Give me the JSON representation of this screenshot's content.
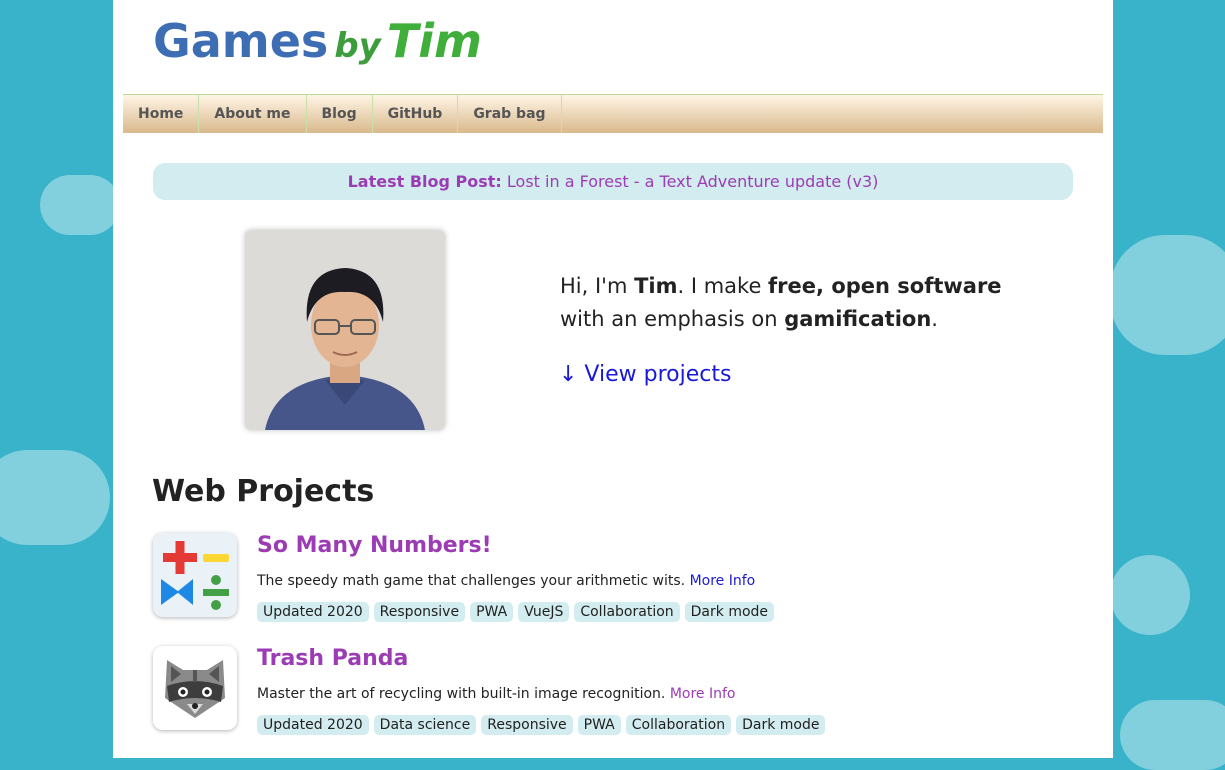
{
  "logo": {
    "word1": "Games",
    "word2": "by",
    "word3": "Tim"
  },
  "nav": {
    "items": [
      {
        "label": "Home"
      },
      {
        "label": "About me"
      },
      {
        "label": "Blog"
      },
      {
        "label": "GitHub"
      },
      {
        "label": "Grab bag"
      }
    ]
  },
  "banner": {
    "label": "Latest Blog Post:",
    "link_text": "Lost in a Forest - a Text Adventure update (v3)"
  },
  "intro": {
    "part1": "Hi, I'm ",
    "name": "Tim",
    "part2": ". I make ",
    "emphasis1": "free, open software",
    "part3": "with an emphasis on ",
    "emphasis2": "gamification",
    "part4": ".",
    "view_link": "↓ View projects"
  },
  "section": {
    "title": "Web Projects"
  },
  "projects": [
    {
      "name": "So Many Numbers!",
      "description": "The speedy math game that challenges your arithmetic wits.",
      "more_info": "More Info",
      "tags": [
        "Updated 2020",
        "Responsive",
        "PWA",
        "VueJS",
        "Collaboration",
        "Dark mode"
      ],
      "icon": "math-operators-icon"
    },
    {
      "name": "Trash Panda",
      "description": "Master the art of recycling with built-in image recognition.",
      "more_info": "More Info",
      "tags": [
        "Updated 2020",
        "Data science",
        "Responsive",
        "PWA",
        "Collaboration",
        "Dark mode"
      ],
      "icon": "raccoon-icon"
    }
  ],
  "colors": {
    "brand_blue": "#3d6eb4",
    "brand_green": "#3fae3b",
    "accent_purple": "#9c3cb4",
    "link_blue": "#1a1ad6",
    "tag_bg": "#d3ecf0",
    "sky": "#38b3c9"
  }
}
